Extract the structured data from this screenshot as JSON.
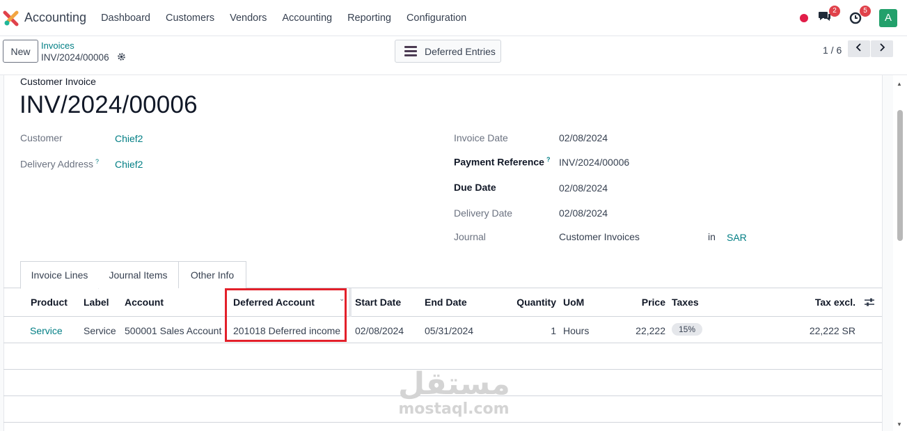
{
  "app": {
    "title": "Accounting"
  },
  "menu": [
    "Dashboard",
    "Customers",
    "Vendors",
    "Accounting",
    "Reporting",
    "Configuration"
  ],
  "nav_right": {
    "messages_count": "2",
    "activities_count": "5",
    "avatar_letter": "A"
  },
  "control": {
    "new_label": "New",
    "breadcrumb_parent": "Invoices",
    "breadcrumb_current": "INV/2024/00006",
    "deferred_button": "Deferred Entries",
    "pager": "1 / 6"
  },
  "invoice": {
    "type_label": "Customer Invoice",
    "name": "INV/2024/00006",
    "fields_left": [
      {
        "label": "Customer",
        "value": "Chief2",
        "help": ""
      },
      {
        "label": "Delivery Address",
        "value": "Chief2",
        "help": "?"
      }
    ],
    "fields_right": [
      {
        "label": "Invoice Date",
        "value": "02/08/2024",
        "help": ""
      },
      {
        "label": "Payment Reference",
        "value": "INV/2024/00006",
        "help": "?"
      },
      {
        "label": "Due Date",
        "value": "02/08/2024",
        "help": ""
      },
      {
        "label": "Delivery Date",
        "value": "02/08/2024",
        "help": ""
      },
      {
        "label": "Journal",
        "value": "Customer Invoices",
        "help": ""
      }
    ],
    "journal_in": "in",
    "currency": "SAR"
  },
  "tabs": [
    "Invoice Lines",
    "Journal Items",
    "Other Info"
  ],
  "table": {
    "headers": [
      "Product",
      "Label",
      "Account",
      "Deferred Account",
      "Start Date",
      "End Date",
      "Quantity",
      "UoM",
      "Price",
      "Taxes",
      "Tax excl."
    ],
    "rows": [
      [
        "Service",
        "Service",
        "500001 Sales Account",
        "201018 Deferred income",
        "02/08/2024",
        "05/31/2024",
        "1",
        "Hours",
        "22,222",
        "15%",
        "22,222 SR"
      ]
    ]
  },
  "watermark": {
    "arabic": "مستقل",
    "latin": "mostaql.com"
  },
  "colors": {
    "link": "#017e84",
    "highlight": "#e3202a",
    "badge": "#e0424b",
    "avatar": "#22a06b"
  }
}
